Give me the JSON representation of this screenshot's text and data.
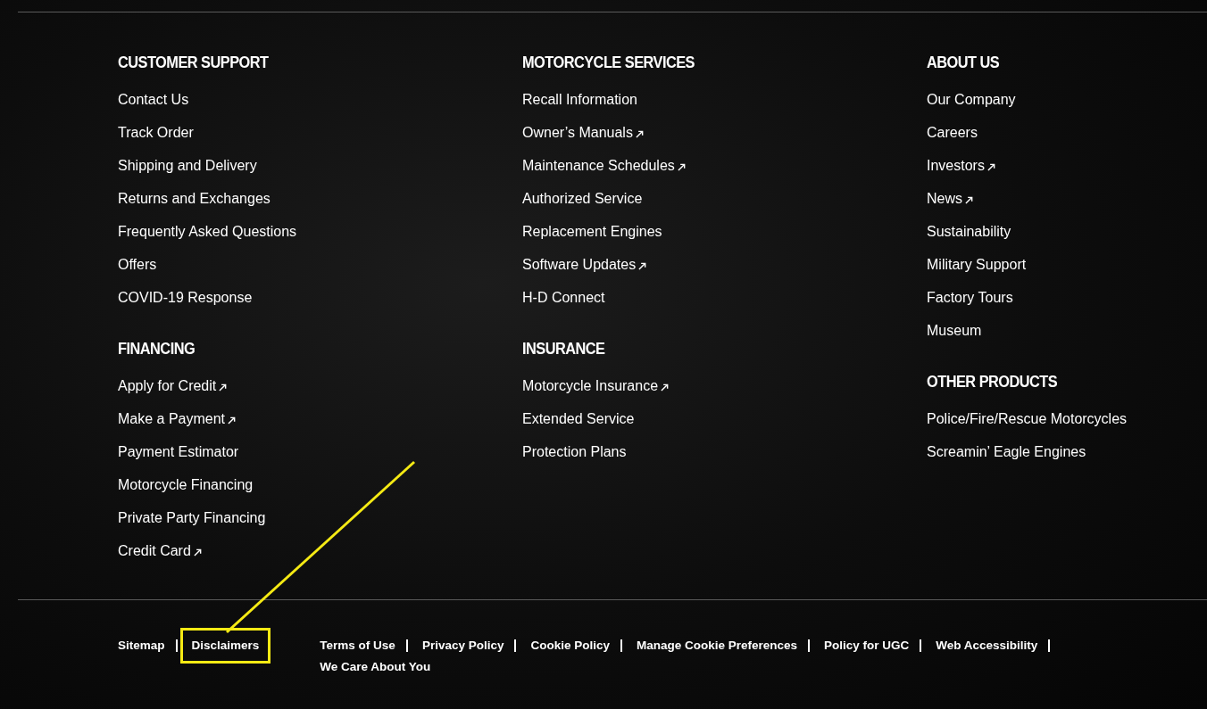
{
  "columns": [
    {
      "sections": [
        {
          "heading": "CUSTOMER SUPPORT",
          "links": [
            {
              "label": "Contact Us",
              "external": false
            },
            {
              "label": "Track Order",
              "external": false
            },
            {
              "label": "Shipping and Delivery",
              "external": false
            },
            {
              "label": "Returns and Exchanges",
              "external": false
            },
            {
              "label": "Frequently Asked Questions",
              "external": false
            },
            {
              "label": "Offers",
              "external": false
            },
            {
              "label": "COVID-19 Response",
              "external": false
            }
          ]
        },
        {
          "heading": "FINANCING",
          "links": [
            {
              "label": "Apply for Credit",
              "external": true
            },
            {
              "label": "Make a Payment",
              "external": true
            },
            {
              "label": "Payment Estimator",
              "external": false
            },
            {
              "label": "Motorcycle Financing",
              "external": false
            },
            {
              "label": "Private Party Financing",
              "external": false
            },
            {
              "label": "Credit Card",
              "external": true
            }
          ]
        }
      ]
    },
    {
      "sections": [
        {
          "heading": "MOTORCYCLE SERVICES",
          "links": [
            {
              "label": "Recall Information",
              "external": false
            },
            {
              "label": "Owner’s Manuals",
              "external": true
            },
            {
              "label": "Maintenance Schedules",
              "external": true
            },
            {
              "label": "Authorized Service",
              "external": false
            },
            {
              "label": "Replacement Engines",
              "external": false
            },
            {
              "label": "Software Updates",
              "external": true
            },
            {
              "label": "H-D Connect",
              "external": false
            }
          ]
        },
        {
          "heading": "INSURANCE",
          "links": [
            {
              "label": "Motorcycle Insurance",
              "external": true
            },
            {
              "label": "Extended Service",
              "external": false
            },
            {
              "label": "Protection Plans",
              "external": false
            }
          ]
        }
      ]
    },
    {
      "sections": [
        {
          "heading": "ABOUT US",
          "links": [
            {
              "label": "Our Company",
              "external": false
            },
            {
              "label": "Careers",
              "external": false
            },
            {
              "label": "Investors",
              "external": true
            },
            {
              "label": "News",
              "external": true
            },
            {
              "label": "Sustainability",
              "external": false
            },
            {
              "label": "Military Support",
              "external": false
            },
            {
              "label": "Factory Tours",
              "external": false
            },
            {
              "label": "Museum",
              "external": false
            }
          ]
        },
        {
          "heading": "OTHER PRODUCTS",
          "links": [
            {
              "label": "Police/Fire/Rescue Motorcycles",
              "external": false
            },
            {
              "label": "Screamin’ Eagle Engines",
              "external": false
            }
          ]
        }
      ]
    }
  ],
  "bottom_links": [
    {
      "label": "Sitemap",
      "highlighted": false
    },
    {
      "label": "Disclaimers",
      "highlighted": true
    }
  ],
  "legal_links": [
    {
      "label": "Terms of Use"
    },
    {
      "label": "Privacy Policy"
    },
    {
      "label": "Cookie Policy"
    },
    {
      "label": "Manage Cookie Preferences"
    },
    {
      "label": "Policy for UGC"
    },
    {
      "label": "Web Accessibility"
    },
    {
      "label": "We Care About You"
    }
  ],
  "annotation": {
    "kind": "arrow"
  }
}
